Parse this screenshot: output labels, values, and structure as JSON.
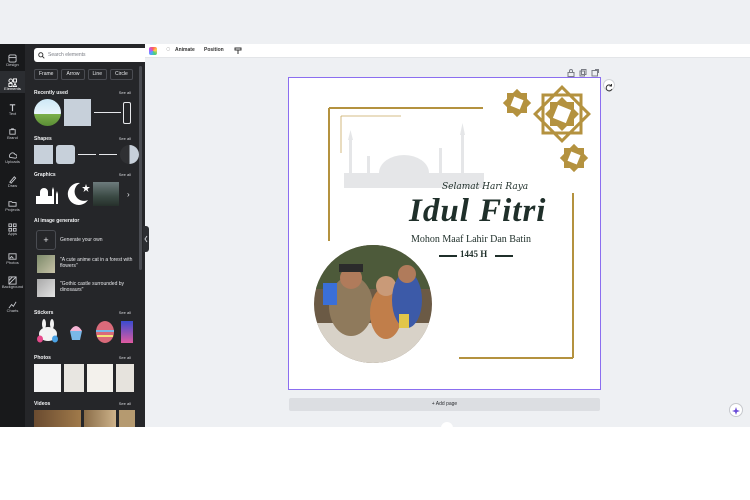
{
  "rail": {
    "items": [
      {
        "label": "Design",
        "icon": "design-icon"
      },
      {
        "label": "Elements",
        "icon": "elements-icon"
      },
      {
        "label": "Text",
        "icon": "text-icon"
      },
      {
        "label": "Brand",
        "icon": "brand-icon"
      },
      {
        "label": "Uploads",
        "icon": "uploads-icon"
      },
      {
        "label": "Draw",
        "icon": "draw-icon"
      },
      {
        "label": "Projects",
        "icon": "projects-icon"
      },
      {
        "label": "Apps",
        "icon": "apps-icon"
      },
      {
        "label": "Photos",
        "icon": "photos-icon"
      },
      {
        "label": "Background",
        "icon": "background-icon"
      },
      {
        "label": "Charts",
        "icon": "charts-icon"
      }
    ],
    "active": "Elements"
  },
  "panel": {
    "search_placeholder": "Search elements",
    "chips": [
      "Frame",
      "Arrow",
      "Line",
      "Circle"
    ],
    "sections": {
      "recently_used": "Recently used",
      "shapes": "Shapes",
      "graphics": "Graphics",
      "ai": "AI image generator",
      "stickers": "Stickers",
      "photos": "Photos",
      "videos": "Videos"
    },
    "see_all": "See all",
    "ai_items": {
      "generate": "Generate your own",
      "prompt1": "\"A cute anime cat in a forest with flowers\"",
      "prompt2": "\"Gothic castle surrounded by dinosaurs\""
    }
  },
  "toolbar": {
    "animate": "Animate",
    "position": "Position"
  },
  "design": {
    "subtitle": "Selamat Hari Raya",
    "title": "Idul Fitri",
    "line": "Mohon Maaf Lahir Dan Batin",
    "year": "1445 H"
  },
  "footer": {
    "add_page": "+ Add page"
  },
  "colors": {
    "accent_purple": "#8b6ef0",
    "gold": "#b4923f",
    "dark_green": "#1f2f2a",
    "panel_bg": "#252629",
    "rail_bg": "#18191b"
  }
}
